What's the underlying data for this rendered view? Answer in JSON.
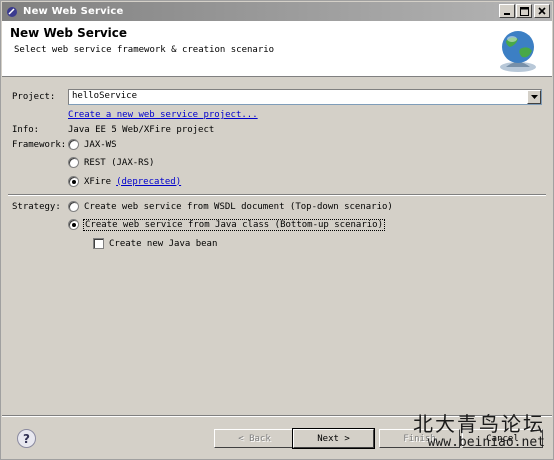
{
  "window": {
    "title": "New Web Service",
    "controls": {
      "minimize": "_",
      "maximize": "□",
      "close": "X"
    }
  },
  "header": {
    "title": "New Web Service",
    "subtitle": "Select web service framework & creation scenario",
    "icon": "globe-icon"
  },
  "form": {
    "project_label": "Project:",
    "project_value": "helloService",
    "create_project_link": "Create a new web service project...",
    "info_label": "Info:",
    "info_value": "Java EE 5 Web/XFire project",
    "framework_label": "Framework:",
    "framework_options": [
      {
        "label": "JAX-WS",
        "selected": false
      },
      {
        "label": "REST (JAX-RS)",
        "selected": false
      },
      {
        "label": "XFire",
        "selected": true
      }
    ],
    "xfire_note": "(deprecated)",
    "strategy_label": "Strategy:",
    "strategy_options": [
      {
        "label": "Create web service from WSDL document (Top-down scenario)",
        "selected": false
      },
      {
        "label": "Create web service from Java class (Bottom-up scenario)",
        "selected": true
      }
    ],
    "create_bean_label": "Create new Java bean",
    "create_bean_checked": false
  },
  "buttons": {
    "help": "?",
    "back": "< Back",
    "next": "Next >",
    "finish": "Finish",
    "cancel": "Cancel"
  },
  "watermark": {
    "line1": "北大青鸟论坛",
    "line2": "www.beiniao.net"
  }
}
